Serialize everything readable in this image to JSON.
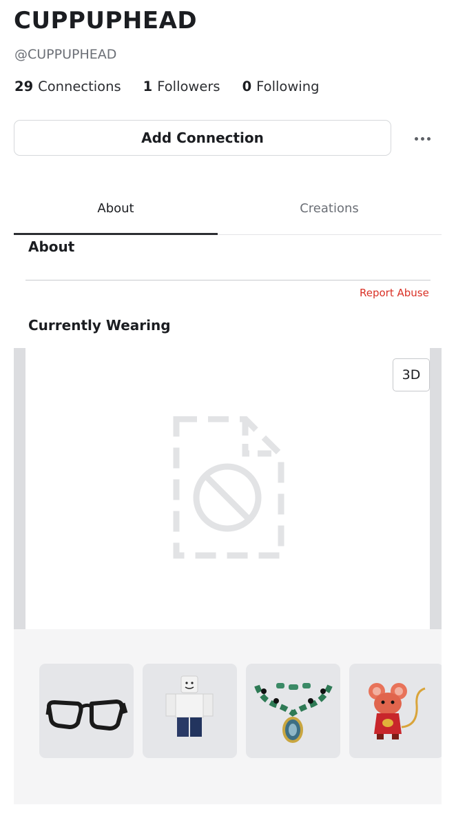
{
  "profile": {
    "display_name": "CUPPUPHEAD",
    "username": "@CUPPUPHEAD"
  },
  "stats": {
    "connections_count": "29",
    "connections_label": "Connections",
    "followers_count": "1",
    "followers_label": "Followers",
    "following_count": "0",
    "following_label": "Following"
  },
  "actions": {
    "add_connection_label": "Add Connection",
    "more_icon": "ellipsis-icon"
  },
  "tabs": [
    {
      "label": "About",
      "active": true
    },
    {
      "label": "Creations",
      "active": false
    }
  ],
  "about": {
    "heading": "About",
    "report_label": "Report Abuse"
  },
  "wearing": {
    "heading": "Currently Wearing",
    "view_toggle_label": "3D",
    "avatar_placeholder_icon": "image-unavailable-icon",
    "items": [
      {
        "name": "glasses",
        "icon": "glasses-icon"
      },
      {
        "name": "shirt",
        "icon": "avatar-shirt-icon"
      },
      {
        "name": "necklace",
        "icon": "necklace-icon"
      },
      {
        "name": "mouse",
        "icon": "mouse-figure-icon"
      }
    ]
  },
  "colors": {
    "report_red": "#d93025",
    "tab_indicator": "#2b2d31",
    "muted_text": "#6b6f76"
  }
}
